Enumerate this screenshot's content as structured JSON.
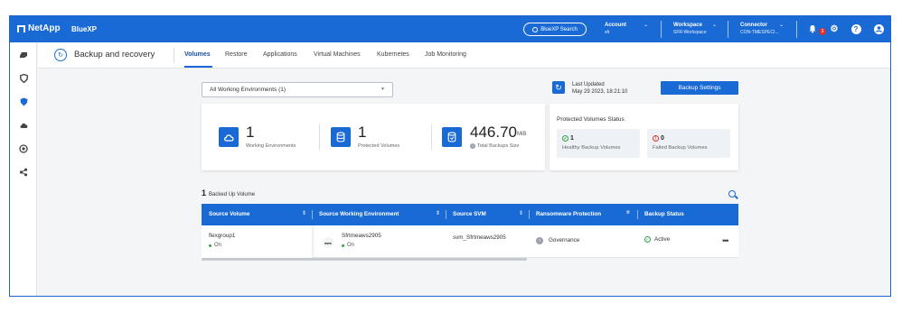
{
  "app": {
    "brand": "NetApp",
    "product": "BlueXP"
  },
  "topbar": {
    "search_label": "BlueXP Search",
    "account": {
      "label": "Account",
      "value": "sfr"
    },
    "workspace": {
      "label": "Workspace",
      "value": "SFR-Workspace"
    },
    "connector": {
      "label": "Connector",
      "value": "CON-TMESPECI..."
    },
    "notification_count": "3"
  },
  "sidebar": {
    "items": [
      "storage-icon",
      "shield-icon",
      "protection-icon",
      "cloud-icon",
      "globe-icon",
      "share-icon"
    ],
    "active_index": 2
  },
  "subnav": {
    "service_title": "Backup and recovery",
    "tabs": [
      {
        "label": "Volumes",
        "active": true
      },
      {
        "label": "Restore"
      },
      {
        "label": "Applications"
      },
      {
        "label": "Virtual Machines"
      },
      {
        "label": "Kubernetes"
      },
      {
        "label": "Job Monitoring"
      }
    ]
  },
  "filter": {
    "working_environments": "All Working Environments (1)"
  },
  "last_updated": {
    "label": "Last Updated",
    "value": "May 29 2023, 18:21:10"
  },
  "backup_settings_label": "Backup Settings",
  "stats": {
    "working_environments": {
      "value": "1",
      "label": "Working Environments"
    },
    "protected_volumes": {
      "value": "1",
      "label": "Protected Volumes"
    },
    "total_backups": {
      "value": "446.70",
      "unit": "MiB",
      "label": "Total Backups Size"
    }
  },
  "protected_status": {
    "title": "Protected Volumes Status",
    "healthy": {
      "count": "1",
      "label": "Healthy Backup Volumes"
    },
    "failed": {
      "count": "0",
      "label": "Failed Backup Volumes"
    }
  },
  "table": {
    "count": "1",
    "title": "Backed Up Volume",
    "columns": [
      "Source Volume",
      "Source Working Environment",
      "Source SVM",
      "Ransomware Protection",
      "Backup Status"
    ],
    "rows": [
      {
        "volume": "flexgroup1",
        "volume_state": "On",
        "provider": "aws",
        "working_environment": "Sfrtmeaws2905",
        "we_state": "On",
        "svm": "svm_Sfrtmeaws2905",
        "ransomware": "Governance",
        "status": "Active"
      }
    ]
  },
  "colors": {
    "primary": "#1a6ad6",
    "ok": "#34a24a",
    "error": "#d9322e"
  }
}
